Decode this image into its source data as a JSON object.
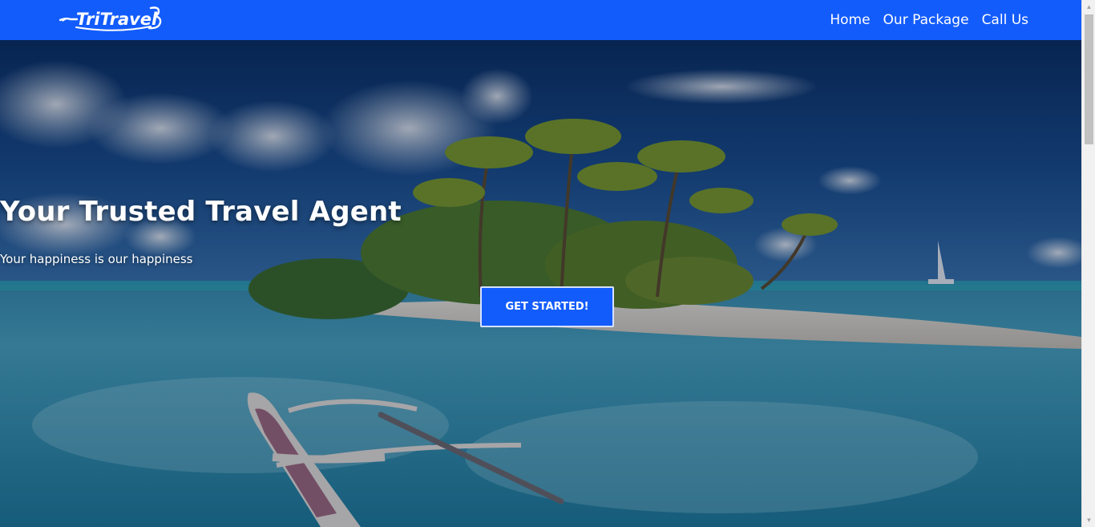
{
  "brand": {
    "name": "TriTravel3",
    "color": "#135cfc"
  },
  "nav": {
    "items": [
      {
        "label": "Home"
      },
      {
        "label": "Our Package"
      },
      {
        "label": "Call Us"
      }
    ]
  },
  "hero": {
    "title": "Your Trusted Travel Agent",
    "subtitle": "Your happiness is our happiness",
    "cta_label": "GET STARTED!",
    "background": "tropical island beach with palm trees and outrigger canoe"
  },
  "scrollbar": {
    "up_icon": "triangle-up-icon",
    "down_icon": "triangle-down-icon"
  }
}
